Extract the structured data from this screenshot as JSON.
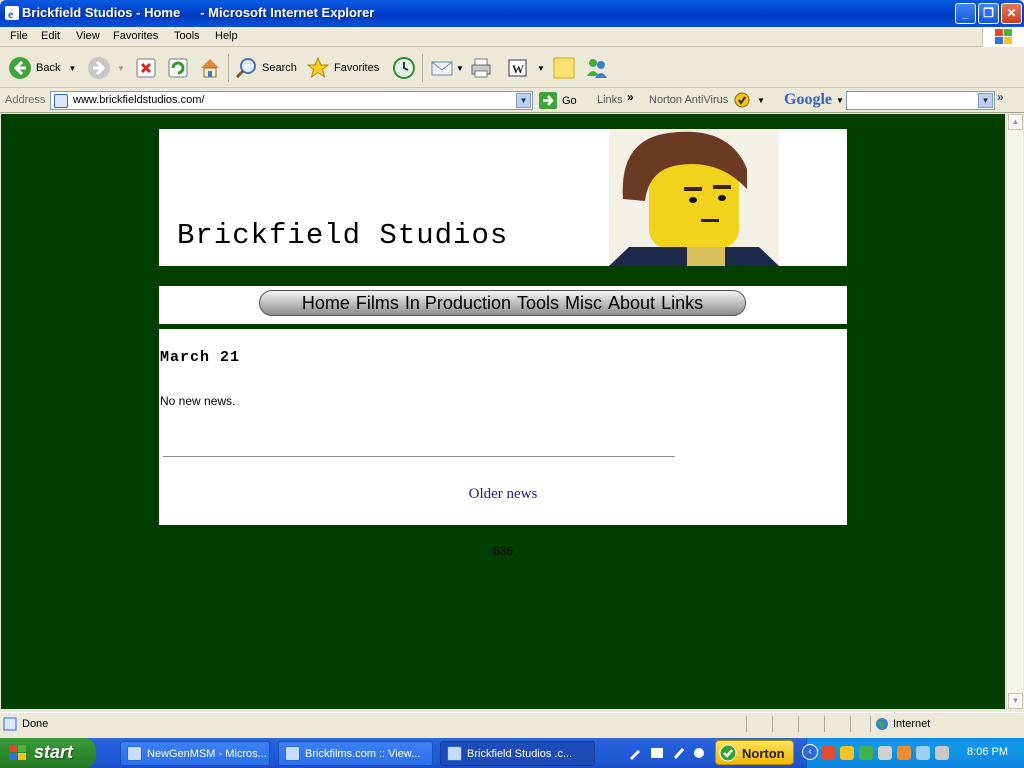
{
  "window": {
    "page_title": "Brickfield Studios - Home",
    "app_title": "- Microsoft Internet Explorer"
  },
  "menu": [
    "File",
    "Edit",
    "View",
    "Favorites",
    "Tools",
    "Help"
  ],
  "toolbar": {
    "back_label": "Back",
    "search_label": "Search",
    "favorites_label": "Favorites"
  },
  "address": {
    "label": "Address",
    "url": "www.brickfieldstudios.com/",
    "go_label": "Go",
    "links_label": "Links",
    "norton_label": "Norton AntiVirus",
    "google_label": "Google"
  },
  "page": {
    "site_title": "Brickfield Studios",
    "nav": [
      "Home",
      "Films",
      "In Production",
      "Tools",
      "Misc",
      "About",
      "Links"
    ],
    "news_date": "March 21",
    "news_text": "No new news.",
    "older_link": "Older news",
    "counter": "636",
    "background_color": "#003f00"
  },
  "status": {
    "text": "Done",
    "zone": "Internet"
  },
  "taskbar": {
    "start_label": "start",
    "buttons": [
      "NewGenMSM - Micros...",
      "Brickfilms.com :: View...",
      "Brickfield Studios .c..."
    ],
    "norton_label": "Norton",
    "clock": "8:06 PM"
  }
}
